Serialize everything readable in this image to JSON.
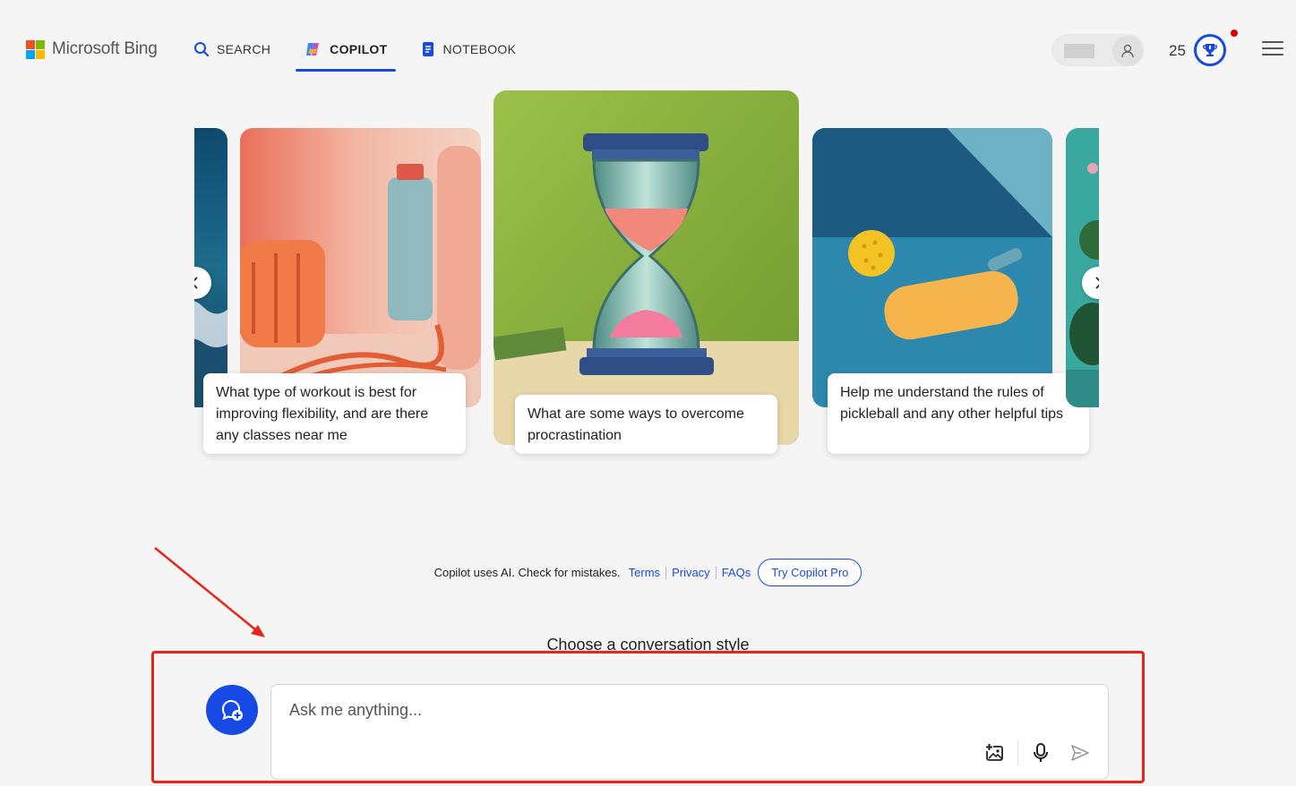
{
  "brand": {
    "name": "Microsoft Bing"
  },
  "nav": {
    "tabs": [
      {
        "label": "SEARCH",
        "icon": "search-icon",
        "active": false
      },
      {
        "label": "COPILOT",
        "icon": "copilot-icon",
        "active": true
      },
      {
        "label": "NOTEBOOK",
        "icon": "notebook-icon",
        "active": false
      }
    ]
  },
  "header": {
    "points": "25",
    "rewards_icon": "trophy-icon",
    "menu_icon": "hamburger-icon",
    "account_icon": "user-icon"
  },
  "carousel": {
    "cards": [
      {
        "caption": "What type of workout is best for improving flexibility, and are there any classes near me",
        "image": "fitness-equipment-illustration"
      },
      {
        "caption": "What are some ways to overcome procrastination",
        "image": "hourglass-illustration"
      },
      {
        "caption": "Help me understand the rules of pickleball and any other helpful tips",
        "image": "pickleball-illustration"
      }
    ],
    "prev_icon": "chevron-left-icon",
    "next_icon": "chevron-right-icon"
  },
  "disclaimer": {
    "text": "Copilot uses AI. Check for mistakes.",
    "links": [
      "Terms",
      "Privacy",
      "FAQs"
    ],
    "pro_button": "Try Copilot Pro"
  },
  "conversation_style": {
    "title": "Choose a conversation style"
  },
  "composer": {
    "placeholder": "Ask me anything...",
    "new_topic_icon": "new-topic-icon",
    "tools": [
      "add-image-icon",
      "microphone-icon",
      "send-icon"
    ]
  },
  "colors": {
    "accent": "#174ae4",
    "annotation": "#e8231a",
    "background": "#f5f5f5"
  }
}
